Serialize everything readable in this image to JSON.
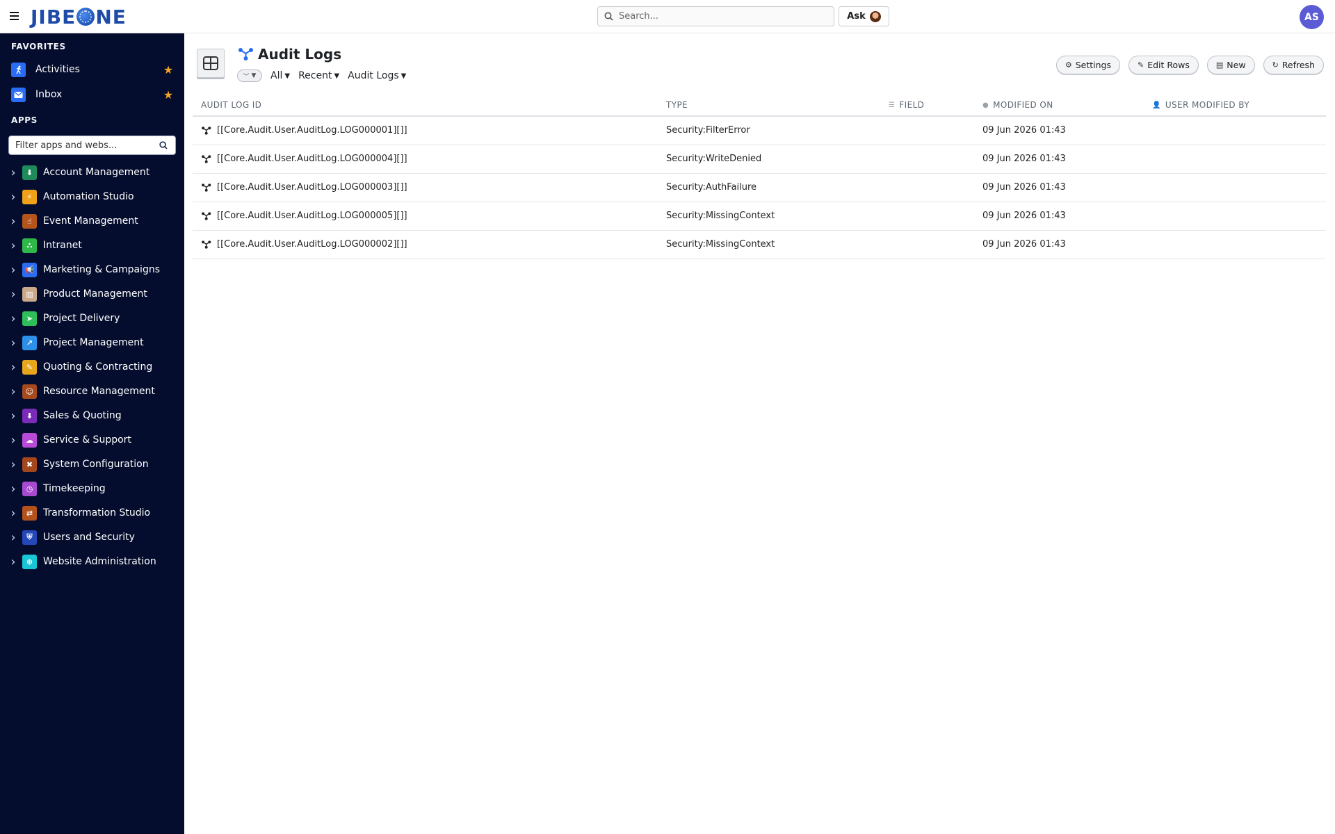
{
  "header": {
    "logo_text_left": "JIBE",
    "logo_text_right": "NE",
    "search_placeholder": "Search...",
    "ask_label": "Ask",
    "user_initials": "AS"
  },
  "sidebar": {
    "favorites_title": "FAVORITES",
    "favorites": [
      {
        "label": "Activities",
        "icon": "running-person-icon",
        "color": "#2a6cf4"
      },
      {
        "label": "Inbox",
        "icon": "envelope-icon",
        "color": "#2a6cf4"
      }
    ],
    "apps_title": "APPS",
    "filter_placeholder": "Filter apps and webs...",
    "apps": [
      {
        "label": "Account Management",
        "color": "#1f8a5a",
        "glyph": "⬇"
      },
      {
        "label": "Automation Studio",
        "color": "#f0a11a",
        "glyph": "⚡"
      },
      {
        "label": "Event Management",
        "color": "#b4551c",
        "glyph": "☝"
      },
      {
        "label": "Intranet",
        "color": "#2fb84a",
        "glyph": "⛬"
      },
      {
        "label": "Marketing & Campaigns",
        "color": "#2a6cf4",
        "glyph": "📢"
      },
      {
        "label": "Product Management",
        "color": "#c9a98a",
        "glyph": "▥"
      },
      {
        "label": "Project Delivery",
        "color": "#2fbf5a",
        "glyph": "➤"
      },
      {
        "label": "Project Management",
        "color": "#2c8fe8",
        "glyph": "↗"
      },
      {
        "label": "Quoting & Contracting",
        "color": "#e8a61c",
        "glyph": "✎"
      },
      {
        "label": "Resource Management",
        "color": "#a44a1e",
        "glyph": "☺"
      },
      {
        "label": "Sales & Quoting",
        "color": "#7a2bb8",
        "glyph": "⬇"
      },
      {
        "label": "Service & Support",
        "color": "#b84ad8",
        "glyph": "☁"
      },
      {
        "label": "System Configuration",
        "color": "#a4461c",
        "glyph": "✖"
      },
      {
        "label": "Timekeeping",
        "color": "#a84ad0",
        "glyph": "◷"
      },
      {
        "label": "Transformation Studio",
        "color": "#b4521c",
        "glyph": "⇄"
      },
      {
        "label": "Users and Security",
        "color": "#2548b8",
        "glyph": "⛨"
      },
      {
        "label": "Website Administration",
        "color": "#19c6d8",
        "glyph": "⊕"
      }
    ]
  },
  "main": {
    "title": "Audit Logs",
    "filters": {
      "all": "All",
      "recent": "Recent",
      "view": "Audit Logs"
    },
    "actions": {
      "settings": "Settings",
      "edit_rows": "Edit Rows",
      "new": "New",
      "refresh": "Refresh"
    },
    "columns": {
      "id": "AUDIT LOG ID",
      "type": "TYPE",
      "field": "FIELD",
      "modified_on": "MODIFIED ON",
      "user_modified_by": "USER MODIFIED BY"
    },
    "rows": [
      {
        "id": "[[Core.Audit.User.AuditLog.LOG000001][]]",
        "type": "Security:FilterError",
        "field": "",
        "modified_on": "09 Jun 2026 01:43",
        "user": ""
      },
      {
        "id": "[[Core.Audit.User.AuditLog.LOG000004][]]",
        "type": "Security:WriteDenied",
        "field": "",
        "modified_on": "09 Jun 2026 01:43",
        "user": ""
      },
      {
        "id": "[[Core.Audit.User.AuditLog.LOG000003][]]",
        "type": "Security:AuthFailure",
        "field": "",
        "modified_on": "09 Jun 2026 01:43",
        "user": ""
      },
      {
        "id": "[[Core.Audit.User.AuditLog.LOG000005][]]",
        "type": "Security:MissingContext",
        "field": "",
        "modified_on": "09 Jun 2026 01:43",
        "user": ""
      },
      {
        "id": "[[Core.Audit.User.AuditLog.LOG000002][]]",
        "type": "Security:MissingContext",
        "field": "",
        "modified_on": "09 Jun 2026 01:43",
        "user": ""
      }
    ]
  }
}
